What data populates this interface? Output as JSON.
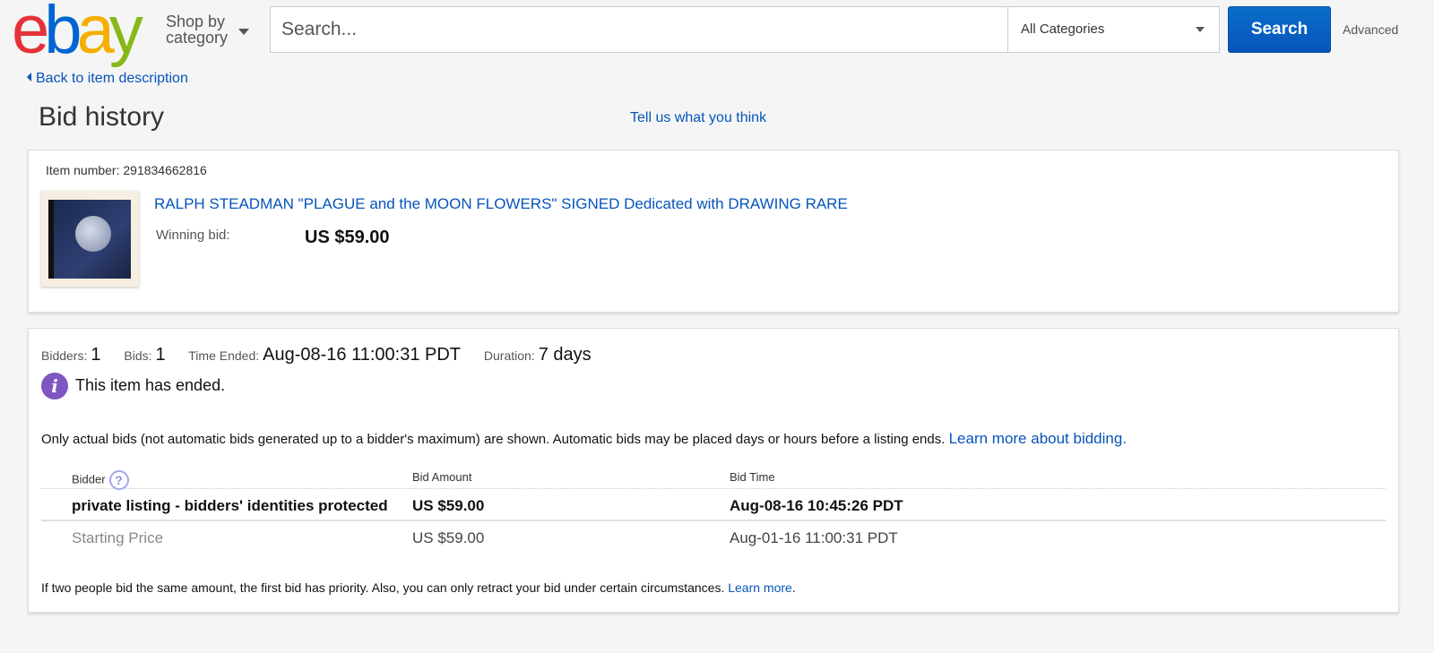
{
  "header": {
    "logo": {
      "e": "e",
      "b": "b",
      "a": "a",
      "y": "y"
    },
    "shop_by_line1": "Shop by",
    "shop_by_line2": "category",
    "search_placeholder": "Search...",
    "category_selected": "All Categories",
    "search_button": "Search",
    "advanced_link": "Advanced"
  },
  "nav": {
    "back_link": "Back to item description",
    "page_title": "Bid history",
    "feedback_link": "Tell us what you think"
  },
  "item": {
    "number_label": "Item number:",
    "number_value": "291834662816",
    "title": "RALPH STEADMAN \"PLAGUE and the MOON FLOWERS\" SIGNED Dedicated with DRAWING RARE",
    "winning_label": "Winning bid:",
    "winning_value": "US $59.00"
  },
  "summary": {
    "bidders_label": "Bidders:",
    "bidders_value": "1",
    "bids_label": "Bids:",
    "bids_value": "1",
    "time_ended_label": "Time Ended:",
    "time_ended_value": "Aug-08-16 11:00:31 PDT",
    "duration_label": "Duration:",
    "duration_value": "7 days",
    "ended_message": "This item has ended.",
    "info_icon_glyph": "i"
  },
  "note": {
    "text": "Only actual bids (not automatic bids generated up to a bidder's maximum) are shown. Automatic bids may be placed days or hours before a listing ends.",
    "link": "Learn more about bidding."
  },
  "table": {
    "headers": {
      "bidder": "Bidder",
      "amount": "Bid Amount",
      "time": "Bid Time"
    },
    "help_glyph": "?",
    "rows": [
      {
        "bidder": "private listing - bidders' identities protected",
        "amount": "US $59.00",
        "time": "Aug-08-16 10:45:26 PDT"
      },
      {
        "bidder": "Starting Price",
        "amount": "US $59.00",
        "time": "Aug-01-16 11:00:31 PDT"
      }
    ]
  },
  "footnote": {
    "text": "If two people bid the same amount, the first bid has priority. Also, you can only retract your bid under certain circumstances.",
    "link": "Learn more",
    "trailing": "."
  },
  "colors": {
    "link": "#0654ba",
    "search_button": "#0654ba",
    "info_icon": "#7e57c2"
  },
  "icons": [
    "ebay-logo",
    "caret-down-icon",
    "back-triangle-icon",
    "info-icon",
    "help-icon"
  ]
}
